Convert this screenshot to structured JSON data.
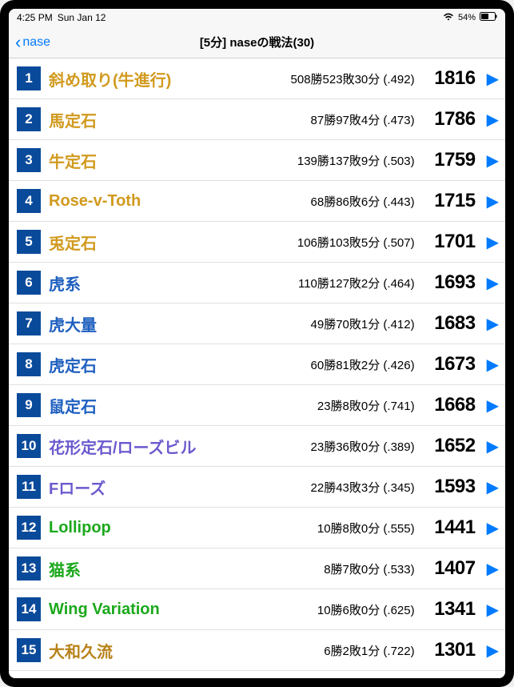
{
  "status": {
    "time": "4:25 PM",
    "date": "Sun Jan 12",
    "battery": "54%",
    "battery_icon": "battery-icon",
    "wifi_icon": "wifi-icon"
  },
  "nav": {
    "back_label": "nase",
    "title": "[5分] naseの戦法(30)"
  },
  "rows": [
    {
      "rank": "1",
      "name": "斜め取り(牛進行)",
      "color": "c-amber",
      "stats": "508勝523敗30分 (.492)",
      "rating": "1816"
    },
    {
      "rank": "2",
      "name": "馬定石",
      "color": "c-amber",
      "stats": "87勝97敗4分 (.473)",
      "rating": "1786"
    },
    {
      "rank": "3",
      "name": "牛定石",
      "color": "c-amber",
      "stats": "139勝137敗9分 (.503)",
      "rating": "1759"
    },
    {
      "rank": "4",
      "name": "Rose-v-Toth",
      "color": "c-amber",
      "stats": "68勝86敗6分 (.443)",
      "rating": "1715"
    },
    {
      "rank": "5",
      "name": "兎定石",
      "color": "c-amber",
      "stats": "106勝103敗5分 (.507)",
      "rating": "1701"
    },
    {
      "rank": "6",
      "name": "虎系",
      "color": "c-blue",
      "stats": "110勝127敗2分 (.464)",
      "rating": "1693"
    },
    {
      "rank": "7",
      "name": "虎大量",
      "color": "c-blue",
      "stats": "49勝70敗1分 (.412)",
      "rating": "1683"
    },
    {
      "rank": "8",
      "name": "虎定石",
      "color": "c-blue",
      "stats": "60勝81敗2分 (.426)",
      "rating": "1673"
    },
    {
      "rank": "9",
      "name": "鼠定石",
      "color": "c-blue",
      "stats": "23勝8敗0分 (.741)",
      "rating": "1668"
    },
    {
      "rank": "10",
      "name": "花形定石/ローズビル",
      "color": "c-purple",
      "stats": "23勝36敗0分 (.389)",
      "rating": "1652"
    },
    {
      "rank": "11",
      "name": "Fローズ",
      "color": "c-purple",
      "stats": "22勝43敗3分 (.345)",
      "rating": "1593"
    },
    {
      "rank": "12",
      "name": "Lollipop",
      "color": "c-green",
      "stats": "10勝8敗0分 (.555)",
      "rating": "1441"
    },
    {
      "rank": "13",
      "name": "猫系",
      "color": "c-green",
      "stats": "8勝7敗0分 (.533)",
      "rating": "1407"
    },
    {
      "rank": "14",
      "name": "Wing Variation",
      "color": "c-green",
      "stats": "10勝6敗0分 (.625)",
      "rating": "1341"
    },
    {
      "rank": "15",
      "name": "大和久流",
      "color": "c-darkamber",
      "stats": "6勝2敗1分 (.722)",
      "rating": "1301"
    }
  ]
}
